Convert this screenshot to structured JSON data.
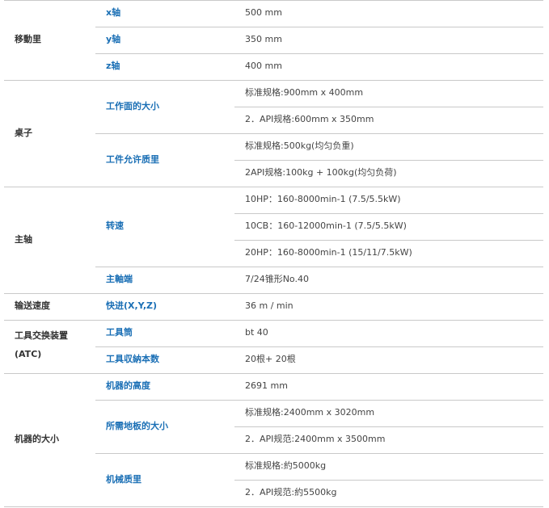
{
  "spec_table": {
    "groups": [
      {
        "category": "移動里",
        "rows": [
          {
            "sub": "x轴",
            "values": [
              "500 mm"
            ]
          },
          {
            "sub": "y轴",
            "values": [
              "350 mm"
            ]
          },
          {
            "sub": "z轴",
            "values": [
              "400 mm"
            ]
          }
        ]
      },
      {
        "category": "桌子",
        "rows": [
          {
            "sub": "工作面的大小",
            "values": [
              "标准规格:900mm x 400mm",
              "2．API规格:600mm x 350mm"
            ]
          },
          {
            "sub": "工件允许质里",
            "values": [
              "标准规格:500kg(均匀负重)",
              "2API规格:100kg + 100kg(均匀负荷)"
            ]
          }
        ]
      },
      {
        "category": "主轴",
        "rows": [
          {
            "sub": "转速",
            "values": [
              "10HP：160-8000min-1 (7.5/5.5kW)",
              "10CB：160-12000min-1 (7.5/5.5kW)",
              "20HP：160-8000min-1 (15/11/7.5kW)"
            ]
          },
          {
            "sub": "主軸端",
            "values": [
              "7/24锥形No.40"
            ]
          }
        ]
      },
      {
        "category": "输送速度",
        "rows": [
          {
            "sub": "快进(X,Y,Z)",
            "values": [
              "36 m / min"
            ]
          }
        ]
      },
      {
        "category_lines": [
          "工具交换装置",
          "(ATC)"
        ],
        "rows": [
          {
            "sub": "工具筒",
            "values": [
              "bt 40"
            ]
          },
          {
            "sub": "工具収納本数",
            "values": [
              "20根+ 20根"
            ]
          }
        ]
      },
      {
        "category": "机器的大小",
        "rows": [
          {
            "sub": "机器的高度",
            "values": [
              "2691 mm"
            ]
          },
          {
            "sub": "所需地板的大小",
            "values": [
              "标准规格:2400mm x 3020mm",
              "2．API规范:2400mm x 3500mm"
            ]
          },
          {
            "sub": "机械质里",
            "values": [
              "标准规格:約5000kg",
              "2．API规范:約5500kg"
            ]
          }
        ]
      }
    ]
  }
}
